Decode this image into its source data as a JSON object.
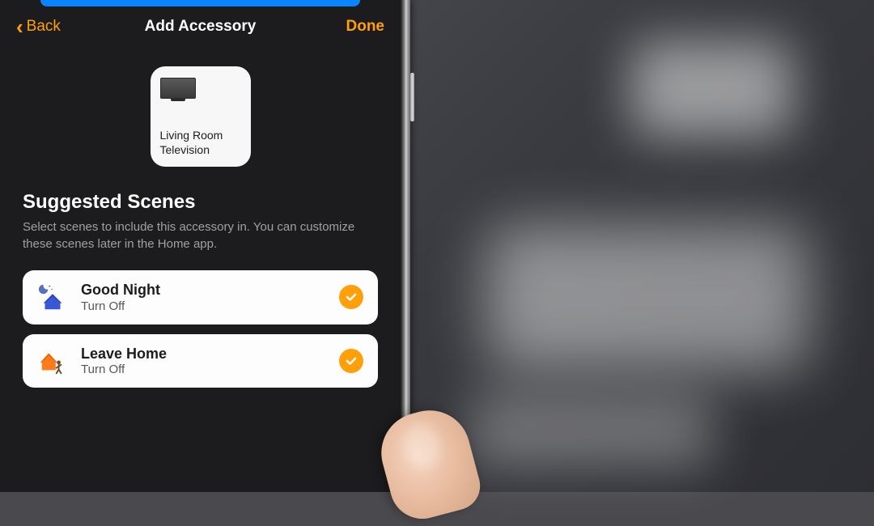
{
  "nav": {
    "back_label": "Back",
    "title": "Add Accessory",
    "done_label": "Done"
  },
  "accessory": {
    "name": "Living Room Television"
  },
  "section": {
    "title": "Suggested Scenes",
    "description": "Select scenes to include this accessory in. You can customize these scenes later in the Home app."
  },
  "scenes": [
    {
      "name": "Good Night",
      "action": "Turn Off",
      "icon": "night-house",
      "selected": true
    },
    {
      "name": "Leave Home",
      "action": "Turn Off",
      "icon": "leave-house",
      "selected": true
    }
  ],
  "colors": {
    "accent": "#ff9f0a",
    "blue": "#0a84ff"
  }
}
